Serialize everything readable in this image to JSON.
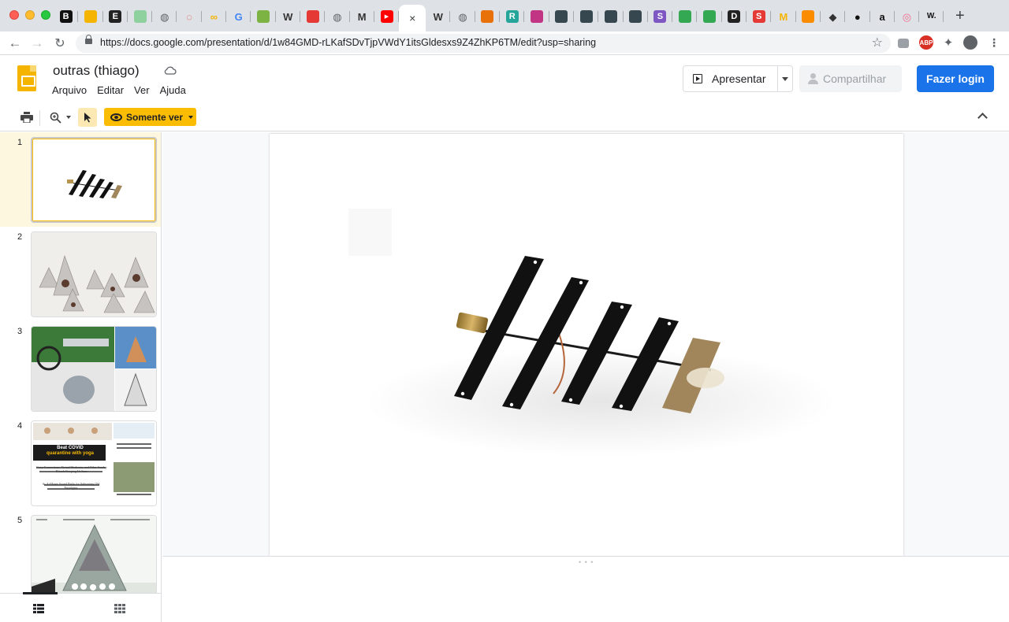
{
  "browser": {
    "url": "https://docs.google.com/presentation/d/1w84GMD-rLKafSDvTjpVWdY1itsGldesxs9Z4ZhKP6TM/edit?usp=sharing",
    "tabs": [
      {
        "icon": "bandcamp-b-icon",
        "glyph": "B",
        "color": "#111111"
      },
      {
        "icon": "slides-yellow-icon",
        "glyph": "",
        "color": "#f4b400"
      },
      {
        "icon": "e-square-icon",
        "glyph": "E",
        "color": "#222222"
      },
      {
        "icon": "sheets-icon",
        "glyph": "",
        "color": "#8fd19e"
      },
      {
        "icon": "globe-icon",
        "glyph": "◍",
        "color": "#5f6368"
      },
      {
        "icon": "drop-icon",
        "glyph": "◌",
        "color": "#e8453c"
      },
      {
        "icon": "infinity-icon",
        "glyph": "∞",
        "color": "#f4b400"
      },
      {
        "icon": "google-g-icon",
        "glyph": "G",
        "color": "#4285f4"
      },
      {
        "icon": "green-app-icon",
        "glyph": "",
        "color": "#7cb342"
      },
      {
        "icon": "wikipedia-icon",
        "glyph": "W",
        "color": "#333333"
      },
      {
        "icon": "red-ribbon-icon",
        "glyph": "",
        "color": "#e53935"
      },
      {
        "icon": "globe-icon",
        "glyph": "◍",
        "color": "#5f6368"
      },
      {
        "icon": "medium-m-icon",
        "glyph": "M",
        "color": "#333333"
      },
      {
        "icon": "youtube-icon",
        "glyph": "▶",
        "color": "#ff0000"
      },
      {
        "icon": "active-tab-close-icon",
        "glyph": "×",
        "color": "#3c4043"
      },
      {
        "icon": "wikipedia-icon",
        "glyph": "W",
        "color": "#333333"
      },
      {
        "icon": "globe-icon",
        "glyph": "◍",
        "color": "#5f6368"
      },
      {
        "icon": "book-icon",
        "glyph": "",
        "color": "#e8710a"
      },
      {
        "icon": "researchgate-icon",
        "glyph": "R",
        "color": "#26a69a"
      },
      {
        "icon": "instagram-icon",
        "glyph": "",
        "color": "#c13584"
      },
      {
        "icon": "arrow-a-icon",
        "glyph": "",
        "color": "#37474f"
      },
      {
        "icon": "arrow-a-icon",
        "glyph": "",
        "color": "#37474f"
      },
      {
        "icon": "arrow-a-icon",
        "glyph": "",
        "color": "#37474f"
      },
      {
        "icon": "arrow-a-icon",
        "glyph": "",
        "color": "#37474f"
      },
      {
        "icon": "s-purple-icon",
        "glyph": "S",
        "color": "#7e57c2"
      },
      {
        "icon": "drive-icon",
        "glyph": "",
        "color": "#34a853"
      },
      {
        "icon": "drive-icon",
        "glyph": "",
        "color": "#34a853"
      },
      {
        "icon": "d-yellow-icon",
        "glyph": "D",
        "color": "#222222"
      },
      {
        "icon": "s-red-icon",
        "glyph": "S",
        "color": "#e53935"
      },
      {
        "icon": "m-yellow-icon",
        "glyph": "M",
        "color": "#f4b400"
      },
      {
        "icon": "orange-blocks-icon",
        "glyph": "",
        "color": "#fb8c00"
      },
      {
        "icon": "diamond-icon",
        "glyph": "◆",
        "color": "#333333"
      },
      {
        "icon": "circle-black-icon",
        "glyph": "●",
        "color": "#111111"
      },
      {
        "icon": "amazon-icon",
        "glyph": "a",
        "color": "#111111"
      },
      {
        "icon": "target-icon",
        "glyph": "◎",
        "color": "#ef6c8a"
      },
      {
        "icon": "w-dot-icon",
        "glyph": "W.",
        "color": "#111111"
      }
    ]
  },
  "app": {
    "title": "outras (thiago)",
    "menu": [
      "Arquivo",
      "Editar",
      "Ver",
      "Ajuda"
    ],
    "present_label": "Apresentar",
    "share_label": "Compartilhar",
    "login_label": "Fazer login",
    "view_only_label": "Somente ver"
  },
  "slides": [
    {
      "number": "1",
      "thumb_kind": "antenna",
      "selected": true
    },
    {
      "number": "2",
      "thumb_kind": "pyramids",
      "selected": false
    },
    {
      "number": "3",
      "thumb_kind": "collage",
      "selected": false
    },
    {
      "number": "4",
      "thumb_kind": "newsletter",
      "selected": false,
      "texts": [
        "Beat COVID",
        "quarantine with yoga",
        "Cozy Connections, Virtual Workouts, and Other Sunday Rituals Keeping Us Sane",
        "As At-Home Sound Baths for Subverting Old Paradigms"
      ]
    },
    {
      "number": "5",
      "thumb_kind": "pyramid-closeup",
      "selected": false
    }
  ],
  "colors": {
    "accent_yellow": "#fbbc04",
    "login_blue": "#1a73e8",
    "selected_slide_bg": "#fef7e0"
  }
}
